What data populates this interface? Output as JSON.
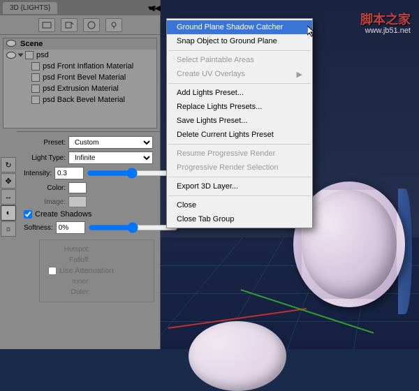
{
  "watermark": {
    "title": "脚本之家",
    "url": "www.jb51.net"
  },
  "panel": {
    "tab_title": "3D {LIGHTS}",
    "scene": {
      "header": "Scene",
      "root": "psd",
      "items": [
        "psd Front Inflation Material",
        "psd Front Bevel Material",
        "psd Extrusion Material",
        "psd Back Bevel Material"
      ]
    },
    "props": {
      "preset_lbl": "Preset:",
      "preset_val": "Custom",
      "light_type_lbl": "Light Type:",
      "light_type_val": "Infinite",
      "intensity_lbl": "Intensity:",
      "intensity_val": "0.3",
      "color_lbl": "Color:",
      "image_lbl": "Image:",
      "create_shadows_lbl": "Create Shadows",
      "softness_lbl": "Softness:",
      "softness_val": "0%",
      "hotspot_lbl": "Hotspot:",
      "falloff_lbl": "Falloff:",
      "use_atten_lbl": "Use Attenuation",
      "inner_lbl": "Inner:",
      "outer_lbl": "Outer:"
    }
  },
  "menu": {
    "items": [
      {
        "label": "Ground Plane Shadow Catcher",
        "hl": true
      },
      {
        "label": "Snap Object to Ground Plane"
      },
      {
        "sep": true
      },
      {
        "label": "Select Paintable Areas",
        "dim": true
      },
      {
        "label": "Create UV Overlays",
        "dim": true,
        "sub": true
      },
      {
        "sep": true
      },
      {
        "label": "Add Lights Preset..."
      },
      {
        "label": "Replace Lights Presets..."
      },
      {
        "label": "Save Lights Preset..."
      },
      {
        "label": "Delete Current Lights Preset"
      },
      {
        "sep": true
      },
      {
        "label": "Resume Progressive Render",
        "dim": true
      },
      {
        "label": "Progressive Render Selection",
        "dim": true
      },
      {
        "sep": true
      },
      {
        "label": "Export 3D Layer..."
      },
      {
        "sep": true
      },
      {
        "label": "Close"
      },
      {
        "label": "Close Tab Group"
      }
    ]
  }
}
